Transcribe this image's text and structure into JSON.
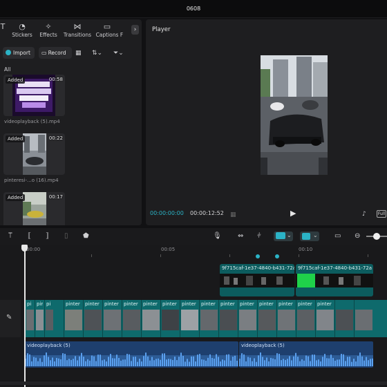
{
  "window": {
    "title": "0608"
  },
  "media_panel": {
    "tabs": [
      {
        "label": "",
        "icon": "text-icon"
      },
      {
        "label": "Stickers",
        "icon": "sticker-icon"
      },
      {
        "label": "Effects",
        "icon": "effects-icon"
      },
      {
        "label": "Transitions",
        "icon": "transitions-icon"
      },
      {
        "label": "Captions",
        "icon": "captions-icon"
      },
      {
        "label": "F",
        "icon": "filter-icon"
      }
    ],
    "import_label": "Import",
    "record_label": "Record",
    "all_label": "All",
    "items": [
      {
        "badge": "Added",
        "duration": "00:58",
        "filename": "videoplayback (5).mp4"
      },
      {
        "badge": "Added",
        "duration": "00:22",
        "filename": "pinteresi-...o (16).mp4"
      },
      {
        "badge": "Added",
        "duration": "00:17",
        "filename": ""
      }
    ]
  },
  "player": {
    "title": "Player",
    "current_time": "00:00:00:00",
    "total_time": "00:00:12:52",
    "full_label": "Full"
  },
  "timeline": {
    "ruler_labels": [
      "00:00",
      "00:05",
      "00:10"
    ],
    "overlay_clips": [
      {
        "label": "9f715caf-1e37-4840-b431-72a"
      },
      {
        "label": "9f715caf-1e37-4840-b431-72a"
      }
    ],
    "main_clips": [
      "pi",
      "pir",
      "pi",
      "pinter",
      "pinter",
      "pinter",
      "pinter",
      "pinter",
      "pinter",
      "pinter",
      "pinter",
      "pinter",
      "pinter",
      "pinter",
      "pinter",
      "pinter",
      "pinter"
    ],
    "audio_clips": [
      {
        "label": "videoplayback (5)"
      },
      {
        "label": "videoplayback (5)"
      }
    ]
  },
  "colors": {
    "accent": "#2bb3c6",
    "main_track": "#0e6a6c",
    "audio_track": "#1e3f6e",
    "panel": "#1e1e20"
  }
}
